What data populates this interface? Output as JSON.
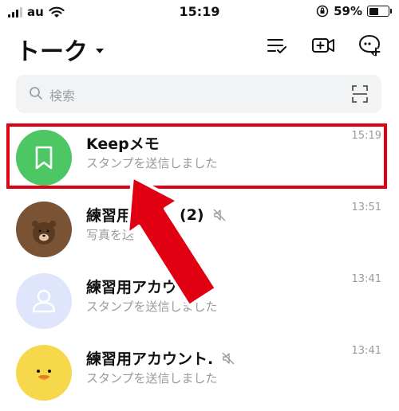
{
  "status_bar": {
    "carrier": "au",
    "time": "15:19",
    "battery_percent": "59%",
    "battery_level": 0.59,
    "signal_bars_on": 3
  },
  "header": {
    "title": "トーク"
  },
  "search": {
    "placeholder": "検索"
  },
  "chats": [
    {
      "name": "Keepメモ",
      "message": "スタンプを送信しました",
      "time": "15:19",
      "avatar": "keep-bookmark",
      "avatar_color": "#4cc764"
    },
    {
      "name": "練習用",
      "suffix": "(2)",
      "message": "写真を送",
      "time": "13:51",
      "avatar": "brown-bear",
      "avatar_color": "#7a5234",
      "muted": true
    },
    {
      "name": "練習用アカウ",
      "message": "スタンプを送信しました",
      "time": "13:41",
      "avatar": "default-person",
      "avatar_color": "#dfe6fb"
    },
    {
      "name": "練習用アカウント.",
      "message": "スタンプを送信しました",
      "time": "13:41",
      "avatar": "sally-chick",
      "avatar_color": "#f7d84b",
      "muted": true
    }
  ],
  "colors": {
    "highlight": "#e00012",
    "line_green": "#4cc764"
  }
}
